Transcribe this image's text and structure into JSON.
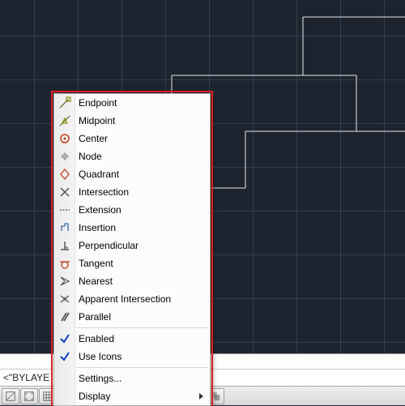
{
  "command_line": "<\"BYLAYE",
  "menu": {
    "items": [
      {
        "label": "Endpoint"
      },
      {
        "label": "Midpoint"
      },
      {
        "label": "Center"
      },
      {
        "label": "Node"
      },
      {
        "label": "Quadrant"
      },
      {
        "label": "Intersection"
      },
      {
        "label": "Extension"
      },
      {
        "label": "Insertion"
      },
      {
        "label": "Perpendicular"
      },
      {
        "label": "Tangent"
      },
      {
        "label": "Nearest"
      },
      {
        "label": "Apparent Intersection"
      },
      {
        "label": "Parallel"
      }
    ],
    "checks": [
      {
        "label": "Enabled"
      },
      {
        "label": "Use Icons"
      }
    ],
    "footer": [
      {
        "label": "Settings..."
      },
      {
        "label": "Display"
      }
    ]
  }
}
